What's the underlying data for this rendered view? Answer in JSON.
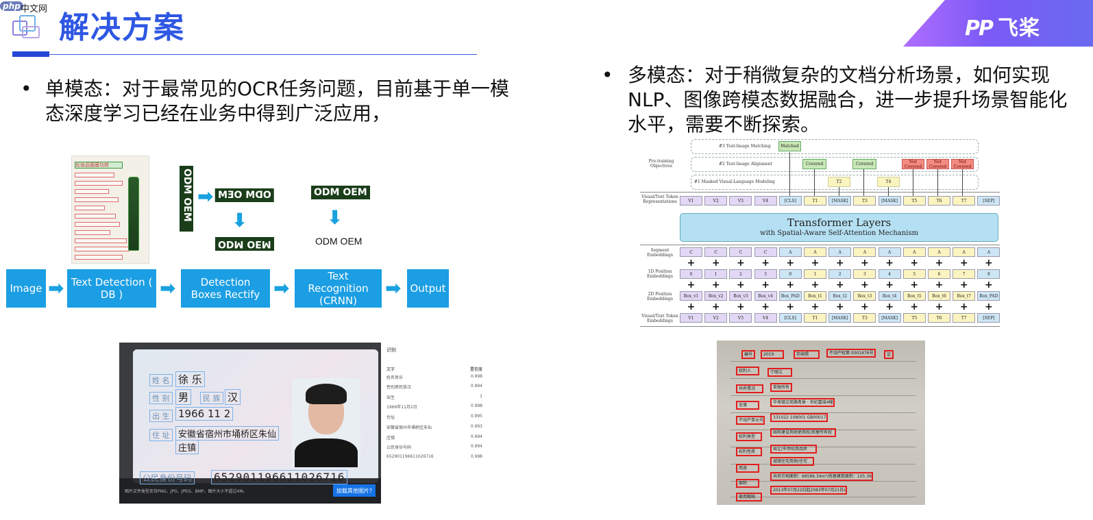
{
  "watermark": {
    "php": "php",
    "site": "中文网"
  },
  "header": {
    "title": "解决方案",
    "brand": "飞桨",
    "brand_mark": "PP"
  },
  "bullets": [
    {
      "dot": "•",
      "text": "单模态：对于最常见的OCR任务问题，目前基于单一模态深度学习已经在业务中得到广泛应用，"
    },
    {
      "dot": "•",
      "text": "多模态：对于稍微复杂的文档分析场景，如何实现NLP、图像跨模态数据融合，进一步提升场景智能化水平，需要不断探索。"
    }
  ],
  "ocr": {
    "doc_header": "化妆品面膜功效",
    "oem_tags": [
      "ODM OEM",
      "ODM OEM",
      "ODM OEM",
      "ODM OEM"
    ],
    "oem_plain": "ODM OEM",
    "pipeline": [
      "Image",
      "Text Detection ( DB )",
      "Detection Boxes Rectify",
      "Text Recognition (CRNN)",
      "Output"
    ],
    "arrow": "➡",
    "arrow_down": "⬇"
  },
  "id_card": {
    "labels": [
      "姓 名",
      "性 别",
      "民 族",
      "出 生",
      "住 址"
    ],
    "name": "徐 乐",
    "gender": "男",
    "ethnicity": "汉",
    "birth": "1966  11  2",
    "address_1": "安徽省宿州市埇桥区朱仙",
    "address_2": "庄镇",
    "number_label": "公民身份号码",
    "number": "652901196611026716",
    "bottom_note": "图片文件类型支持PNG、JPG、JPEG、BMP，图片大小不超过4M。",
    "upload_button": "加载其他图片?",
    "results_header": "识别",
    "results_cols": [
      "文字",
      "置信度"
    ],
    "results": [
      {
        "text": "姓名徐乐",
        "conf": "0.998"
      },
      {
        "text": "性别男民族汉",
        "conf": "0.994"
      },
      {
        "text": "出生",
        "conf": "1"
      },
      {
        "text": "1966年11月2日",
        "conf": "0.998"
      },
      {
        "text": "住址",
        "conf": "0.995"
      },
      {
        "text": "安徽省宿州市埇桥区朱仙",
        "conf": "0.993"
      },
      {
        "text": "庄镇",
        "conf": "0.994"
      },
      {
        "text": "公民身份号码",
        "conf": "0.994"
      },
      {
        "text": "652901196611026716",
        "conf": "0.998"
      }
    ]
  },
  "diagram": {
    "row_labels": {
      "pretrain": "Pre-training Objectives",
      "repr": "Visual/Text Token Representations",
      "seg": "Segment Embeddings",
      "pos1d": "1D Position Embeddings",
      "pos2d": "2D Position Embeddings",
      "tok": "Visual/Text Token Embeddings"
    },
    "objectives": [
      "#3 Text-Image Matching",
      "#2 Text-Image Alignment",
      "#1 Masked Visual-Language Modeling"
    ],
    "matched": "Matched",
    "covered": "Covered",
    "not_covered": "Not Covered",
    "masked_targets": [
      "T2",
      "T4"
    ],
    "tokens": [
      "V1",
      "V2",
      "V3",
      "V4",
      "[CLS]",
      "T1",
      "[MASK]",
      "T3",
      "[MASK]",
      "T5",
      "T6",
      "T7",
      "[SEP]"
    ],
    "segments": [
      "C",
      "C",
      "C",
      "C",
      "A",
      "A",
      "A",
      "A",
      "A",
      "A",
      "A",
      "A",
      "A"
    ],
    "pos1d": [
      "0",
      "1",
      "2",
      "3",
      "0",
      "1",
      "2",
      "3",
      "4",
      "5",
      "6",
      "7",
      "8"
    ],
    "pos2d": [
      "Box_v1",
      "Box_v2",
      "Box_v3",
      "Box_v4",
      "Box_PAD",
      "Box_t1",
      "Box_t2",
      "Box_t3",
      "Box_t4",
      "Box_t5",
      "Box_t6",
      "Box_t7",
      "Box_PAD"
    ],
    "plus": "+",
    "transformer_title": "Transformer Layers",
    "transformer_sub": "with Spatial-Aware Self-Attention Mechanism"
  },
  "cert": {
    "boxes": [
      "编号",
      "2019",
      "存续照",
      "不动产权第 0001476号",
      "证",
      "权利人",
      "共有情况",
      "坐落",
      "不动产单元号",
      "权利类型",
      "权利性质",
      "用途",
      "面积",
      "使用期限",
      "宁丽江",
      "单独所有",
      "华埠镇文苑路粤景 · 世纪嘉城4幢1-2201",
      "331022 108001 GB00017 F00340128",
      "国有建设用地使用权/房屋所有权",
      "出让/市场化商品房",
      "城镇住宅用地/住宅",
      "共有宗地面积：68586.34m²/房屋建筑面积：105.36m²",
      "2013年07月22日起2083年07月21日止"
    ]
  }
}
